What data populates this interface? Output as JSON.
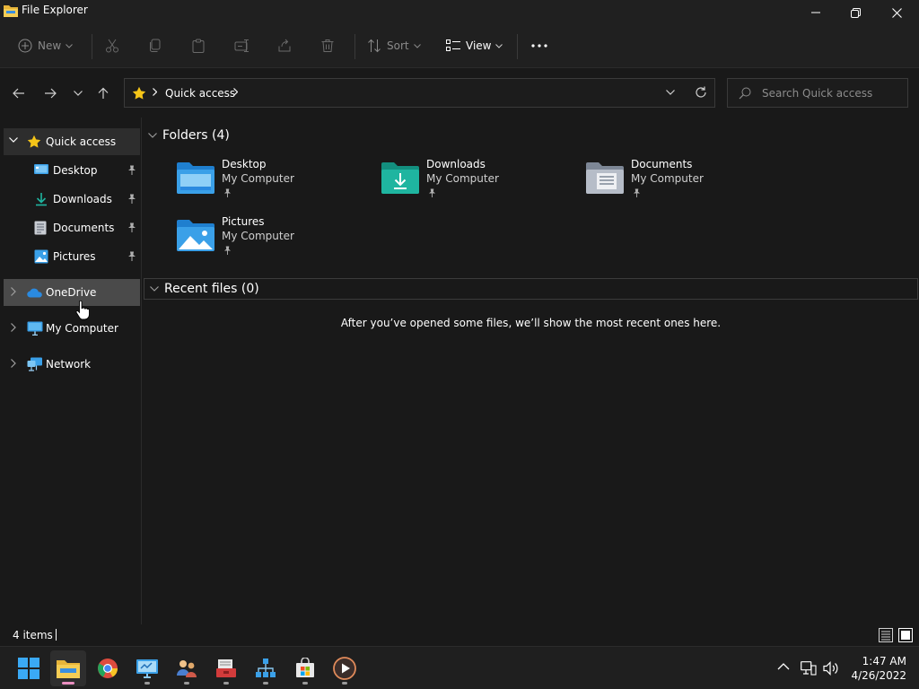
{
  "window": {
    "title": "File Explorer"
  },
  "command_bar": {
    "new_label": "New",
    "sort_label": "Sort",
    "view_label": "View"
  },
  "address_bar": {
    "location": "Quick access",
    "search_placeholder": "Search Quick access"
  },
  "sidebar": {
    "quick_access": "Quick access",
    "pinned": [
      {
        "label": "Desktop",
        "icon": "desktop-icon"
      },
      {
        "label": "Downloads",
        "icon": "downloads-icon"
      },
      {
        "label": "Documents",
        "icon": "documents-icon"
      },
      {
        "label": "Pictures",
        "icon": "pictures-icon"
      }
    ],
    "onedrive": "OneDrive",
    "my_computer": "My Computer",
    "network": "Network"
  },
  "content": {
    "folders_header": "Folders (4)",
    "folders": [
      {
        "name": "Desktop",
        "location": "My Computer"
      },
      {
        "name": "Downloads",
        "location": "My Computer"
      },
      {
        "name": "Documents",
        "location": "My Computer"
      },
      {
        "name": "Pictures",
        "location": "My Computer"
      }
    ],
    "recent_header": "Recent files (0)",
    "recent_empty_message": "After you’ve opened some files, we’ll show the most recent ones here."
  },
  "status_bar": {
    "item_count": "4 items"
  },
  "taskbar": {
    "time": "1:47 AM",
    "date": "4/26/2022"
  },
  "colors": {
    "accent_folder": "#3aa0e8",
    "downloads_folder": "#1fb5a0",
    "star": "#f5c518",
    "active_indicator": "#e98ec0"
  }
}
